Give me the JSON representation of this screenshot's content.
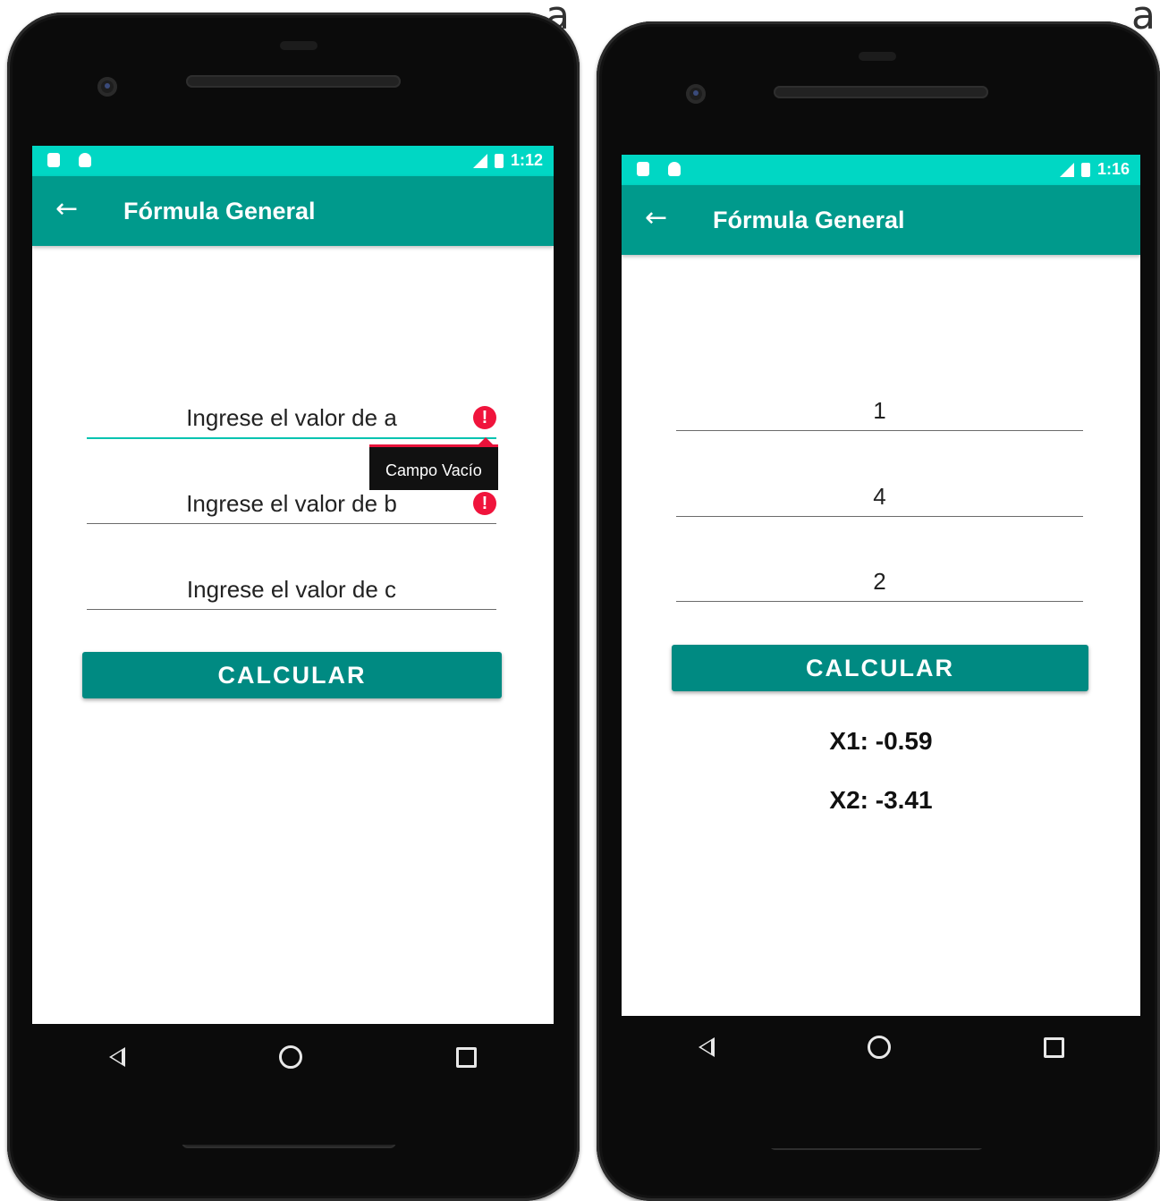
{
  "left_phone": {
    "status_time": "1:12",
    "app_title": "Fórmula General",
    "fields": [
      {
        "placeholder": "Ingrese el valor de a",
        "error": true
      },
      {
        "placeholder": "Ingrese el valor de b",
        "error": true
      },
      {
        "placeholder": "Ingrese el valor de c",
        "error": false
      }
    ],
    "error_tooltip": "Campo Vacío",
    "button_label": "CALCULAR"
  },
  "right_phone": {
    "status_time": "1:16",
    "app_title": "Fórmula General",
    "fields": [
      {
        "value": "1"
      },
      {
        "value": "4"
      },
      {
        "value": "2"
      }
    ],
    "button_label": "CALCULAR",
    "result_x1": "X1: -0.59",
    "result_x2": "X2: -3.41"
  },
  "background_text": "a",
  "colors": {
    "status_bar": "#00d7c4",
    "app_bar": "#009a8c",
    "button": "#008a82",
    "error": "#f0143c",
    "focus_line": "#00c3b0"
  },
  "icons": [
    "back-arrow-icon",
    "error-icon",
    "nav-back-icon",
    "nav-home-icon",
    "nav-recent-icon",
    "signal-icon",
    "battery-icon"
  ]
}
